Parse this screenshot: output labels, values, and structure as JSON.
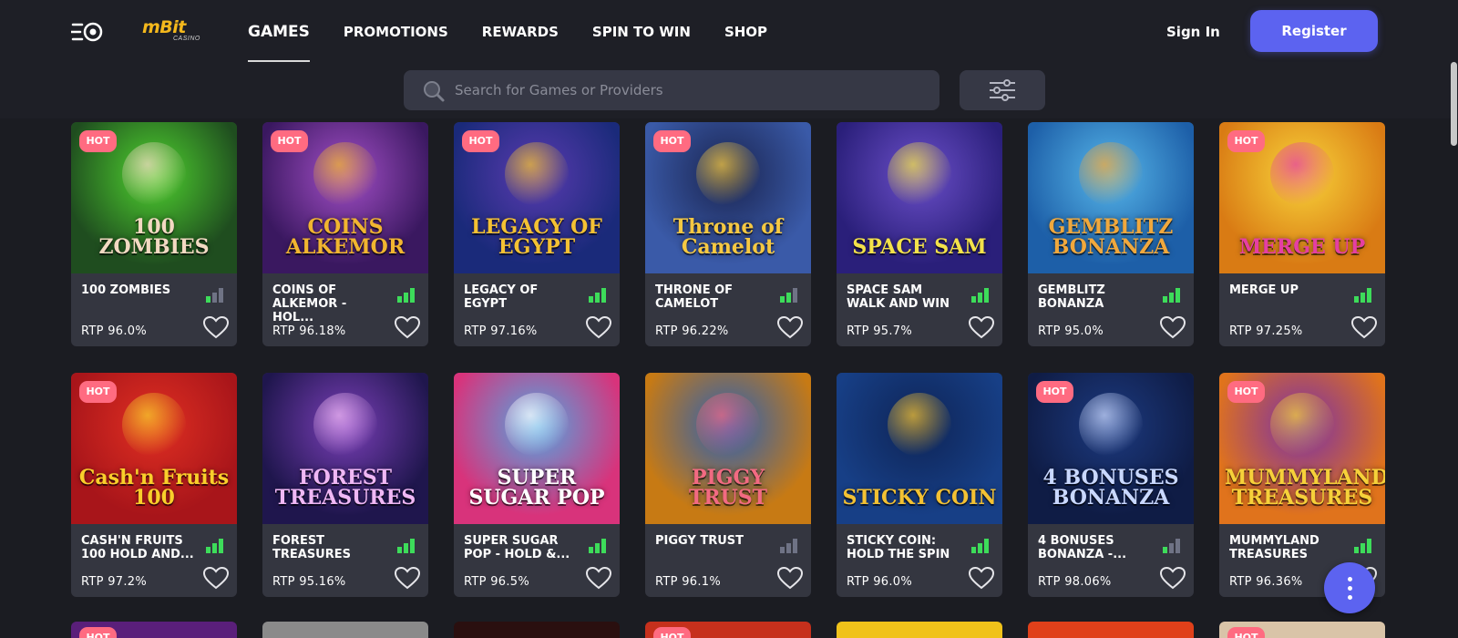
{
  "header": {
    "menu_icon": "rocket-menu-icon",
    "logo_text": "mBit",
    "logo_sub": "CASINO",
    "nav": [
      "GAMES",
      "PROMOTIONS",
      "REWARDS",
      "SPIN TO WIN",
      "SHOP"
    ],
    "active_nav": "GAMES",
    "sign_in": "Sign In",
    "register": "Register"
  },
  "search": {
    "placeholder": "Search for Games or Providers",
    "icon": "search-icon",
    "filter_icon": "sliders-icon"
  },
  "games": [
    {
      "title": "100 ZOMBIES",
      "art": "100 ZOMBIES",
      "rtp": "RTP 96.0%",
      "hot": true,
      "signal": 1,
      "bg": "#1f4d1f",
      "bg2": "#4fd32f",
      "accent": "#f2d9c2"
    },
    {
      "title": "COINS OF ALKEMOR - HOL...",
      "art": "COINS ALKEMOR",
      "rtp": "RTP 96.18%",
      "hot": true,
      "signal": 3,
      "bg": "#3a1860",
      "bg2": "#a34fc7",
      "accent": "#f1b530"
    },
    {
      "title": "LEGACY OF EGYPT",
      "art": "LEGACY OF EGYPT",
      "rtp": "RTP 97.16%",
      "hot": true,
      "signal": 3,
      "bg": "#1a2a7a",
      "bg2": "#5a3bb0",
      "accent": "#f4c133"
    },
    {
      "title": "THRONE OF CAMELOT",
      "art": "Throne of Camelot",
      "rtp": "RTP 96.22%",
      "hot": true,
      "signal": 2,
      "bg": "#3a5aa8",
      "bg2": "#1a2450",
      "accent": "#f5c842"
    },
    {
      "title": "SPACE SAM WALK AND WIN",
      "art": "SPACE SAM",
      "rtp": "RTP 95.7%",
      "hot": false,
      "signal": 3,
      "bg": "#2a1f7a",
      "bg2": "#6b4fc9",
      "accent": "#f3e24a"
    },
    {
      "title": "GEMBLITZ BONANZA",
      "art": "GEMBLITZ BONANZA",
      "rtp": "RTP 95.0%",
      "hot": false,
      "signal": 3,
      "bg": "#1d5fa8",
      "bg2": "#57b7ea",
      "accent": "#f0a83d"
    },
    {
      "title": "MERGE UP",
      "art": "MERGE UP",
      "rtp": "RTP 97.25%",
      "hot": true,
      "signal": 3,
      "bg": "#d97b14",
      "bg2": "#f8d43a",
      "accent": "#e53fa3"
    },
    {
      "title": "CASH'N FRUITS 100 HOLD AND...",
      "art": "Cash'n Fruits 100",
      "rtp": "RTP 97.2%",
      "hot": true,
      "signal": 3,
      "bg": "#a8151a",
      "bg2": "#e02f22",
      "accent": "#f9cf2b"
    },
    {
      "title": "FOREST TREASURES",
      "art": "FOREST TREASURES",
      "rtp": "RTP 95.16%",
      "hot": false,
      "signal": 3,
      "bg": "#1f164d",
      "bg2": "#7a3fb8",
      "accent": "#f0b8f5"
    },
    {
      "title": "SUPER SUGAR POP - HOLD &...",
      "art": "SUPER SUGAR POP",
      "rtp": "RTP 96.5%",
      "hot": false,
      "signal": 3,
      "bg": "#d8337b",
      "bg2": "#4fa8e3",
      "accent": "#ffffff"
    },
    {
      "title": "PIGGY TRUST",
      "art": "PIGGY TRUST",
      "rtp": "RTP 96.1%",
      "hot": false,
      "signal": 0,
      "bg": "#c77a14",
      "bg2": "#2a60b5",
      "accent": "#f26a82"
    },
    {
      "title": "STICKY COIN: HOLD THE SPIN",
      "art": "STICKY COIN",
      "rtp": "RTP 96.0%",
      "hot": false,
      "signal": 3,
      "bg": "#173f86",
      "bg2": "#0e2456",
      "accent": "#f3c133"
    },
    {
      "title": "4 BONUSES BONANZA -...",
      "art": "4 BONUSES BONANZA",
      "rtp": "RTP 98.06%",
      "hot": true,
      "signal": 1,
      "bg": "#0f1c45",
      "bg2": "#1c3a80",
      "accent": "#c9d8ff"
    },
    {
      "title": "MUMMYLAND TREASURES",
      "art": "MUMMYLAND TREASURES",
      "rtp": "RTP 96.36%",
      "hot": true,
      "signal": 3,
      "bg": "#e0731c",
      "bg2": "#7a2fa8",
      "accent": "#f6d13a"
    }
  ],
  "peek_row": [
    {
      "hot": true,
      "bg": "#5a1f7a"
    },
    {
      "hot": false,
      "bg": "#8a8a8a"
    },
    {
      "hot": false,
      "bg": "#2a0f0f"
    },
    {
      "hot": true,
      "bg": "#c6301c"
    },
    {
      "hot": false,
      "bg": "#f0c21a"
    },
    {
      "hot": false,
      "bg": "#e0401a"
    },
    {
      "hot": true,
      "bg": "#d9c4a8"
    }
  ],
  "hot_label": "HOT",
  "fab_icon": "more-vertical-icon",
  "colors": {
    "accent": "#5c63f0",
    "signal_on": "#3ddc5a",
    "signal_off": "#6f7385",
    "hot": "#ff6b81"
  }
}
